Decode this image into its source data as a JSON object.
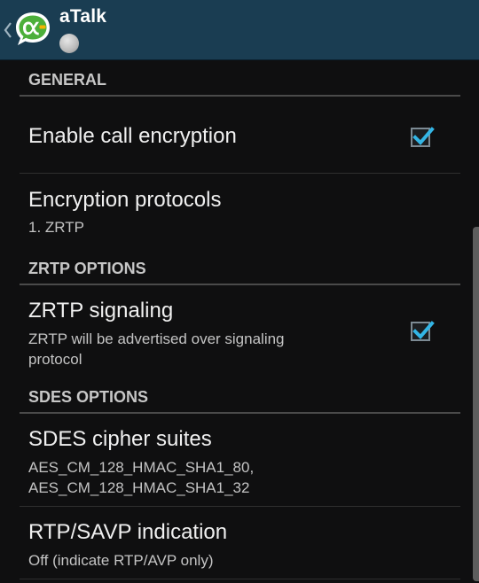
{
  "app": {
    "title": "aTalk",
    "logo_icon": "atalk-logo-icon",
    "status_icon": "presence-status-icon",
    "actionbar_color": "#1a3d52"
  },
  "sections": {
    "general": {
      "header": "GENERAL",
      "enable_call_encryption": {
        "title": "Enable call encryption",
        "checked": true
      },
      "encryption_protocols": {
        "title": "Encryption protocols",
        "summary": "1. ZRTP"
      }
    },
    "zrtp": {
      "header": "ZRTP OPTIONS",
      "zrtp_signaling": {
        "title": "ZRTP signaling",
        "summary_line1": "ZRTP will be advertised over signaling",
        "summary_line2": "protocol",
        "checked": true
      }
    },
    "sdes": {
      "header": "SDES OPTIONS",
      "cipher_suites": {
        "title": "SDES cipher suites",
        "summary_line1": "AES_CM_128_HMAC_SHA1_80,",
        "summary_line2": "AES_CM_128_HMAC_SHA1_32"
      },
      "rtp_savp": {
        "title": "RTP/SAVP indication",
        "summary": "Off (indicate RTP/AVP only)"
      }
    }
  },
  "accent_color": "#33b5e5"
}
